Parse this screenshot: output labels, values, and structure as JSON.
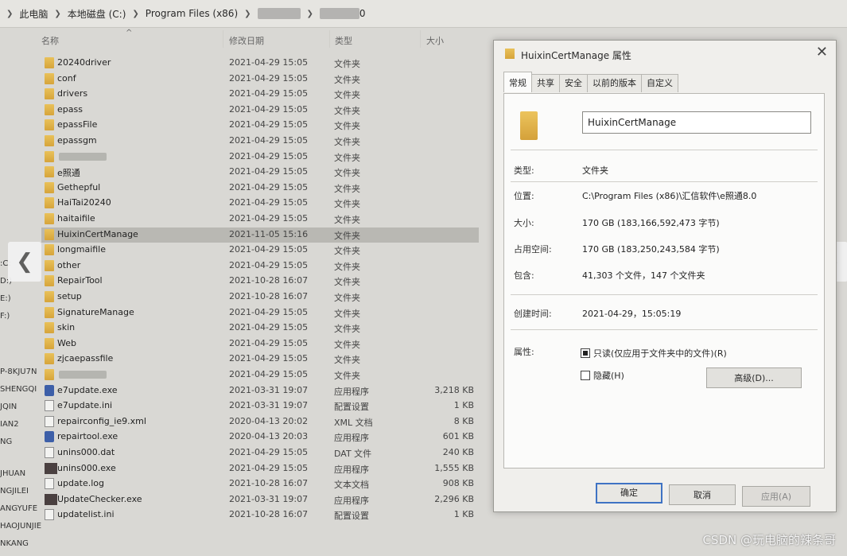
{
  "address": {
    "segments": [
      "此电脑",
      "本地磁盘 (C:)",
      "Program Files (x86)"
    ],
    "last_visible_fragment": "0"
  },
  "columns": {
    "name": "名称",
    "modified": "修改日期",
    "type": "类型",
    "size": "大小"
  },
  "leftnav": [
    ":C:",
    "D:)",
    "E:)",
    "F:)",
    "P-8KJU7N",
    "SHENGQI",
    "JQIN",
    "IAN2",
    "NG",
    "JHUAN",
    "NGJILEI",
    "ANGYUFE",
    "HAOJUNJIE",
    "NKANG"
  ],
  "files": [
    {
      "name": "20240driver",
      "date": "2021-04-29 15:05",
      "type": "文件夹",
      "size": "",
      "icon": "folder"
    },
    {
      "name": "conf",
      "date": "2021-04-29 15:05",
      "type": "文件夹",
      "size": "",
      "icon": "folder"
    },
    {
      "name": "drivers",
      "date": "2021-04-29 15:05",
      "type": "文件夹",
      "size": "",
      "icon": "folder"
    },
    {
      "name": "epass",
      "date": "2021-04-29 15:05",
      "type": "文件夹",
      "size": "",
      "icon": "folder"
    },
    {
      "name": "epassFile",
      "date": "2021-04-29 15:05",
      "type": "文件夹",
      "size": "",
      "icon": "folder"
    },
    {
      "name": "epassgm",
      "date": "2021-04-29 15:05",
      "type": "文件夹",
      "size": "",
      "icon": "folder"
    },
    {
      "name": "",
      "date": "2021-04-29 15:05",
      "type": "文件夹",
      "size": "",
      "icon": "folder"
    },
    {
      "name": "e照通",
      "date": "2021-04-29 15:05",
      "type": "文件夹",
      "size": "",
      "icon": "folder"
    },
    {
      "name": "Gethepful",
      "date": "2021-04-29 15:05",
      "type": "文件夹",
      "size": "",
      "icon": "folder"
    },
    {
      "name": "HaiTai20240",
      "date": "2021-04-29 15:05",
      "type": "文件夹",
      "size": "",
      "icon": "folder"
    },
    {
      "name": "haitaifile",
      "date": "2021-04-29 15:05",
      "type": "文件夹",
      "size": "",
      "icon": "folder"
    },
    {
      "name": "HuixinCertManage",
      "date": "2021-11-05 15:16",
      "type": "文件夹",
      "size": "",
      "icon": "folder",
      "selected": true
    },
    {
      "name": "longmaifile",
      "date": "2021-04-29 15:05",
      "type": "文件夹",
      "size": "",
      "icon": "folder"
    },
    {
      "name": "other",
      "date": "2021-04-29 15:05",
      "type": "文件夹",
      "size": "",
      "icon": "folder"
    },
    {
      "name": "RepairTool",
      "date": "2021-10-28 16:07",
      "type": "文件夹",
      "size": "",
      "icon": "folder"
    },
    {
      "name": "setup",
      "date": "2021-10-28 16:07",
      "type": "文件夹",
      "size": "",
      "icon": "folder"
    },
    {
      "name": "SignatureManage",
      "date": "2021-04-29 15:05",
      "type": "文件夹",
      "size": "",
      "icon": "folder"
    },
    {
      "name": "skin",
      "date": "2021-04-29 15:05",
      "type": "文件夹",
      "size": "",
      "icon": "folder"
    },
    {
      "name": "Web",
      "date": "2021-04-29 15:05",
      "type": "文件夹",
      "size": "",
      "icon": "folder"
    },
    {
      "name": "zjcaepassfile",
      "date": "2021-04-29 15:05",
      "type": "文件夹",
      "size": "",
      "icon": "folder"
    },
    {
      "name": "",
      "date": "2021-04-29 15:05",
      "type": "文件夹",
      "size": "",
      "icon": "folder"
    },
    {
      "name": "e7update.exe",
      "date": "2021-03-31 19:07",
      "type": "应用程序",
      "size": "3,218 KB",
      "icon": "exe"
    },
    {
      "name": "e7update.ini",
      "date": "2021-03-31 19:07",
      "type": "配置设置",
      "size": "1 KB",
      "icon": "file"
    },
    {
      "name": "repairconfig_ie9.xml",
      "date": "2020-04-13 20:02",
      "type": "XML 文档",
      "size": "8 KB",
      "icon": "file"
    },
    {
      "name": "repairtool.exe",
      "date": "2020-04-13 20:03",
      "type": "应用程序",
      "size": "601 KB",
      "icon": "exe"
    },
    {
      "name": "unins000.dat",
      "date": "2021-04-29 15:05",
      "type": "DAT 文件",
      "size": "240 KB",
      "icon": "file"
    },
    {
      "name": "unins000.exe",
      "date": "2021-04-29 15:05",
      "type": "应用程序",
      "size": "1,555 KB",
      "icon": "dark"
    },
    {
      "name": "update.log",
      "date": "2021-10-28 16:07",
      "type": "文本文档",
      "size": "908 KB",
      "icon": "file"
    },
    {
      "name": "UpdateChecker.exe",
      "date": "2021-03-31 19:07",
      "type": "应用程序",
      "size": "2,296 KB",
      "icon": "dark"
    },
    {
      "name": "updatelist.ini",
      "date": "2021-10-28 16:07",
      "type": "配置设置",
      "size": "1 KB",
      "icon": "file"
    }
  ],
  "dialog": {
    "title": "HuixinCertManage 属性",
    "close_glyph": "✕",
    "tabs": [
      "常规",
      "共享",
      "安全",
      "以前的版本",
      "自定义"
    ],
    "active_tab": 0,
    "folder_name": "HuixinCertManage",
    "labels": {
      "type": "类型:",
      "location": "位置:",
      "size": "大小:",
      "size_on_disk": "占用空间:",
      "contains": "包含:",
      "created": "创建时间:",
      "attributes": "属性:"
    },
    "values": {
      "type": "文件夹",
      "location": "C:\\Program Files (x86)\\汇信软件\\e照通8.0",
      "size": "170 GB (183,166,592,473 字节)",
      "size_on_disk": "170 GB (183,250,243,584 字节)",
      "contains": "41,303 个文件，147 个文件夹",
      "created": "2021-04-29，15:05:19"
    },
    "readonly_label": "只读(仅应用于文件夹中的文件)(R)",
    "hidden_label": "隐藏(H)",
    "advanced_button": "高级(D)...",
    "ok_button": "确定",
    "cancel_button": "取消",
    "apply_button": "应用(A)"
  },
  "nav": {
    "prev_glyph": "❮",
    "next_glyph": "❯"
  },
  "watermark": "CSDN @玩电脑的辣条哥",
  "colors": {
    "selected_row": "#b9b8b3",
    "folder": "#e0b44c",
    "primary_border": "#3f73c4"
  }
}
